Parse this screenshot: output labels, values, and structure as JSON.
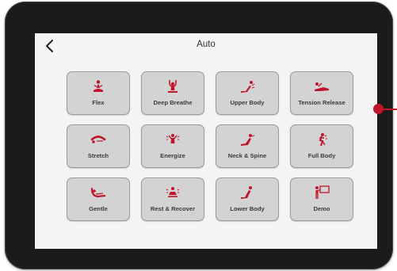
{
  "header": {
    "title": "Auto"
  },
  "accent_color": "#c0162b",
  "programs": [
    {
      "label": "Flex",
      "icon": "meditation-pose-icon"
    },
    {
      "label": "Deep Breathe",
      "icon": "arms-raised-icon"
    },
    {
      "label": "Upper Body",
      "icon": "upper-body-recline-icon"
    },
    {
      "label": "Tension Release",
      "icon": "tension-release-icon"
    },
    {
      "label": "Stretch",
      "icon": "stretch-icon"
    },
    {
      "label": "Energize",
      "icon": "energize-icon"
    },
    {
      "label": "Neck & Spine",
      "icon": "neck-spine-icon"
    },
    {
      "label": "Full Body",
      "icon": "full-body-icon"
    },
    {
      "label": "Gentle",
      "icon": "gentle-recline-icon"
    },
    {
      "label": "Rest & Recover",
      "icon": "rest-recover-icon"
    },
    {
      "label": "Lower Body",
      "icon": "lower-body-recline-icon"
    },
    {
      "label": "Demo",
      "icon": "presentation-board-icon"
    }
  ]
}
